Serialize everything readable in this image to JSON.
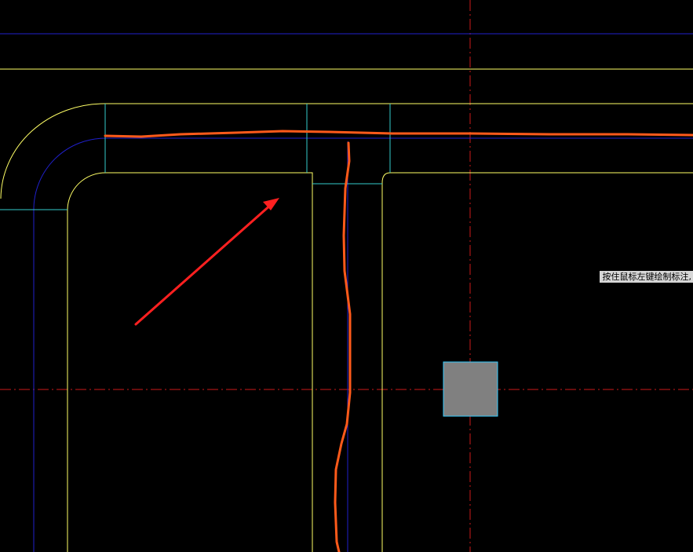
{
  "canvas": {
    "background_color": "#000000",
    "colors": {
      "wall_outline": "#ffff66",
      "centerline_blue": "#2020cc",
      "axis_line_red": "#cc1a1a",
      "joint_line_cyan": "#33cccc",
      "orange_markup": "#ff5a1a",
      "red_arrow": "#ff2020",
      "column_fill": "#808080",
      "column_border": "#33ccff"
    },
    "elements": {
      "annotation_arrow": "arrow-icon",
      "column": "column-square"
    }
  },
  "status": {
    "command_tooltip": "按住鼠标左键绘制标注,"
  }
}
